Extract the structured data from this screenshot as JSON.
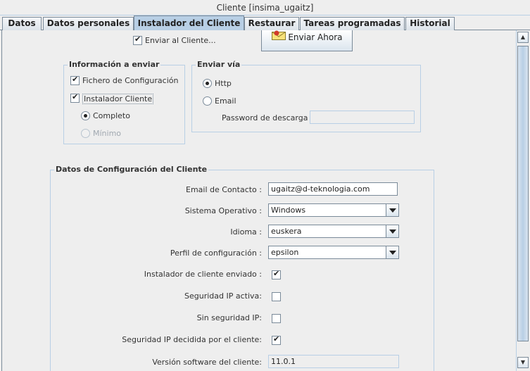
{
  "window": {
    "title": "Cliente [insima_ugaitz]"
  },
  "tabs": [
    {
      "label": "Datos"
    },
    {
      "label": "Datos personales"
    },
    {
      "label": "Instalador del Cliente"
    },
    {
      "label": "Restaurar"
    },
    {
      "label": "Tareas programadas"
    },
    {
      "label": "Historial"
    }
  ],
  "send": {
    "checkbox_label": "Enviar al Cliente...",
    "checked": true,
    "button_label": "Enviar Ahora"
  },
  "info_group": {
    "title": "Información a enviar",
    "config_file": {
      "label": "Fichero de Configuración",
      "checked": true
    },
    "installer": {
      "label": "Instalador Cliente",
      "checked": true
    },
    "complete": {
      "label": "Completo",
      "selected": true
    },
    "minimum": {
      "label": "Mínimo",
      "selected": false,
      "disabled": true
    }
  },
  "via_group": {
    "title": "Enviar vía",
    "http": {
      "label": "Http",
      "selected": true
    },
    "email": {
      "label": "Email",
      "selected": false
    },
    "password_label": "Password de descarga",
    "password_value": ""
  },
  "config": {
    "title": "Datos de Configuración del Cliente",
    "email_label": "Email de Contacto :",
    "email_value": "ugaitz@d-teknologia.com",
    "os_label": "Sistema Operativo :",
    "os_value": "Windows",
    "lang_label": "Idioma :",
    "lang_value": "euskera",
    "profile_label": "Perfil de configuración :",
    "profile_value": "epsilon",
    "installer_sent_label": "Instalador de cliente enviado :",
    "installer_sent": true,
    "ip_security_label": "Seguridad IP activa:",
    "ip_security": false,
    "no_ip_security_label": "Sin seguridad IP:",
    "no_ip_security": false,
    "ip_client_label": "Seguridad IP decidida por el cliente:",
    "ip_client": true,
    "version_label": "Versión software del cliente:",
    "version_value": "11.0.1"
  },
  "colors": {
    "active_tab": "#b8cfe5",
    "border": "#7a8a99",
    "background": "#eeeeee"
  }
}
